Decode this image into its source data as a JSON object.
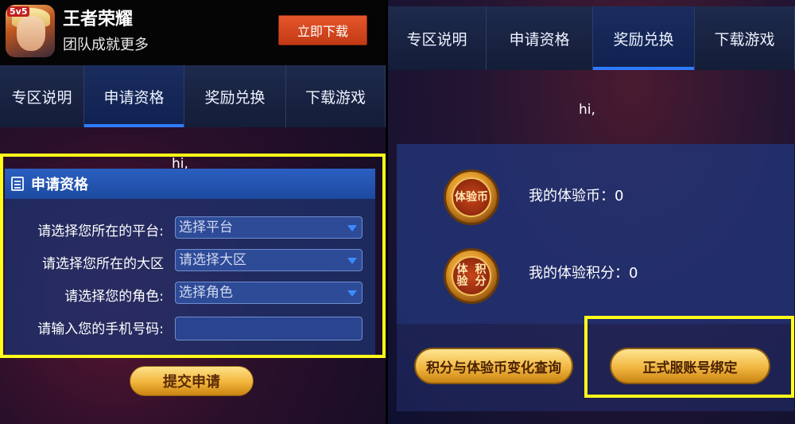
{
  "left": {
    "app_header": {
      "badge": "5v5",
      "title": "王者荣耀",
      "subtitle": "团队成就更多",
      "download_label": "立即下载"
    },
    "tabs": [
      {
        "label": "专区说明",
        "active": false
      },
      {
        "label": "申请资格",
        "active": true
      },
      {
        "label": "奖励兑换",
        "active": false
      },
      {
        "label": "下载游戏",
        "active": false
      }
    ],
    "greeting": "hi,",
    "form": {
      "title": "申请资格",
      "platform": {
        "label": "请选择您所在的平台:",
        "value": "选择平台"
      },
      "region": {
        "label": "请选择您所在的大区",
        "value": "请选择大区"
      },
      "role": {
        "label": "请选择您的角色:",
        "value": "选择角色"
      },
      "phone": {
        "label": "请输入您的手机号码:",
        "value": ""
      }
    },
    "submit_label": "提交申请"
  },
  "right": {
    "tabs": [
      {
        "label": "专区说明",
        "active": false
      },
      {
        "label": "申请资格",
        "active": false
      },
      {
        "label": "奖励兑换",
        "active": true
      },
      {
        "label": "下载游戏",
        "active": false
      }
    ],
    "greeting": "hi,",
    "coin_label": "体验币",
    "points_badge_line1": "体验",
    "points_badge_line2": "积分",
    "coins_text": "我的体验币：0",
    "points_text": "我的体验积分：0",
    "query_button": "积分与体验币变化查询",
    "bind_button": "正式服账号绑定"
  },
  "colors": {
    "highlight": "#ffff1a",
    "tab_active_underline": "#2f7bff",
    "download_button": "#d84a20",
    "gold_button": "#f2b640"
  }
}
